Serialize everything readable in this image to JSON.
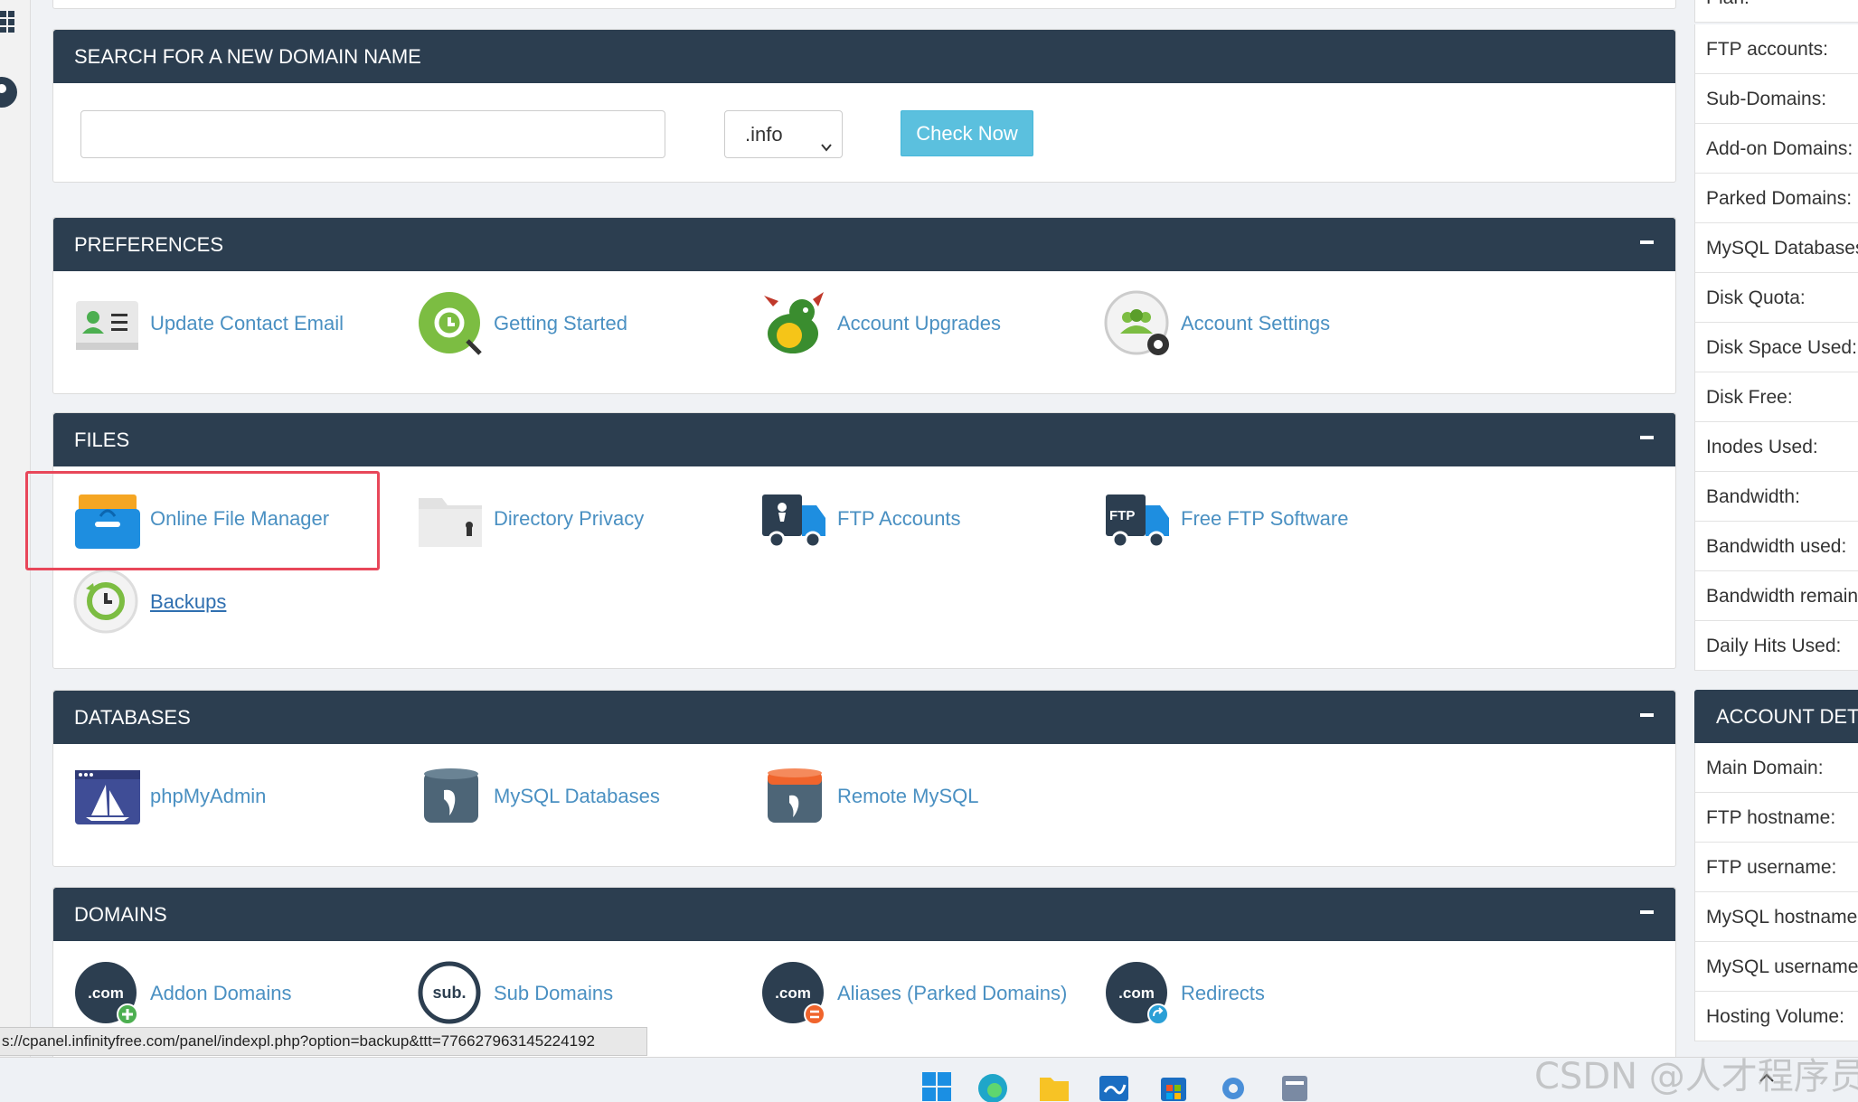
{
  "search_panel": {
    "title": "SEARCH FOR A NEW DOMAIN NAME",
    "input_value": "",
    "tld_selected": ".info",
    "button_label": "Check Now"
  },
  "preferences": {
    "title": "PREFERENCES",
    "items": [
      {
        "label": "Update Contact Email",
        "icon": "contact-card-icon"
      },
      {
        "label": "Getting Started",
        "icon": "getting-started-icon"
      },
      {
        "label": "Account Upgrades",
        "icon": "dragon-icon"
      },
      {
        "label": "Account Settings",
        "icon": "account-settings-icon"
      }
    ]
  },
  "files": {
    "title": "FILES",
    "items": [
      {
        "label": "Online File Manager",
        "icon": "file-manager-icon"
      },
      {
        "label": "Directory Privacy",
        "icon": "folder-lock-icon"
      },
      {
        "label": "FTP Accounts",
        "icon": "ftp-truck-icon"
      },
      {
        "label": "Free FTP Software",
        "icon": "ftp-software-icon"
      },
      {
        "label": "Backups",
        "icon": "backup-icon"
      }
    ]
  },
  "databases": {
    "title": "DATABASES",
    "items": [
      {
        "label": "phpMyAdmin",
        "icon": "phpmyadmin-icon"
      },
      {
        "label": "MySQL Databases",
        "icon": "mysql-database-icon"
      },
      {
        "label": "Remote MySQL",
        "icon": "remote-mysql-icon"
      }
    ]
  },
  "domains": {
    "title": "DOMAINS",
    "items": [
      {
        "label": "Addon Domains",
        "icon": "dotcom-add-icon",
        "badge": ".com",
        "badge_color": "#4caf50"
      },
      {
        "label": "Sub Domains",
        "icon": "sub-domain-icon",
        "badge": "sub."
      },
      {
        "label": "Aliases (Parked Domains)",
        "icon": "dotcom-alias-icon",
        "badge": ".com",
        "badge_color": "#f0642c"
      },
      {
        "label": "Redirects",
        "icon": "dotcom-redirect-icon",
        "badge": ".com",
        "badge_color": "#2a9fd6"
      }
    ]
  },
  "stats_sidebar": {
    "rows": [
      "Plan:",
      "FTP accounts:",
      "Sub-Domains:",
      "Add-on Domains:",
      "Parked Domains:",
      "MySQL Databases:",
      "Disk Quota:",
      "Disk Space Used:",
      "Disk Free:",
      "Inodes Used:",
      "Bandwidth:",
      "Bandwidth used:",
      "Bandwidth remaining:",
      "Daily Hits Used:"
    ]
  },
  "account_details": {
    "title": "ACCOUNT DETAILS",
    "rows": [
      "Main Domain:",
      "FTP hostname:",
      "FTP username:",
      "MySQL hostname:",
      "MySQL username:",
      "Hosting Volume:"
    ]
  },
  "status_bar_url": "s://cpanel.infinityfree.com/panel/indexpl.php?option=backup&ttt=776627963145224192",
  "watermark": "CSDN @人才程序员",
  "colors": {
    "panel_header": "#2c3e50",
    "link": "#4a90c2",
    "button": "#5bc0de",
    "highlight": "#e8475a"
  }
}
